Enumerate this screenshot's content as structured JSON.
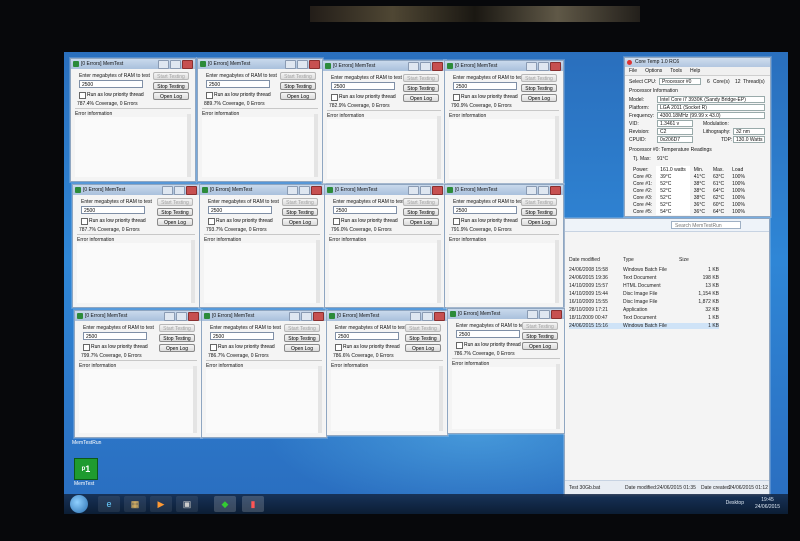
{
  "memtest": {
    "title": "[0 Errors] MemTest",
    "prompt": "Enter megabytes of RAM to test",
    "ram_value": "2500",
    "start_label": "Start Testing",
    "stop_label": "Stop Testing",
    "log_label": "Open Log",
    "priority_label": "Run as low priority thread",
    "error_label": "Error information",
    "windows": [
      {
        "coverage": "787.4% Coverage, 0 Errors"
      },
      {
        "coverage": "889.7% Coverage, 0 Errors"
      },
      {
        "coverage": "782.9% Coverage, 0 Errors"
      },
      {
        "coverage": "790.9% Coverage, 0 Errors"
      },
      {
        "coverage": "787.7% Coverage, 0 Errors"
      },
      {
        "coverage": "793.7% Coverage, 0 Errors"
      },
      {
        "coverage": "796.0% Coverage, 0 Errors"
      },
      {
        "coverage": "791.9% Coverage, 0 Errors"
      },
      {
        "coverage": "799.7% Coverage, 0 Errors"
      },
      {
        "coverage": "786.7% Coverage, 0 Errors"
      },
      {
        "coverage": "786.6% Coverage, 0 Errors"
      },
      {
        "coverage": "786.7% Coverage, 0 Errors"
      }
    ]
  },
  "coretemp": {
    "title": "Core Temp 1.0 RC6",
    "menu": [
      "File",
      "Options",
      "Tools",
      "Help"
    ],
    "select_cpu": "Select CPU:",
    "processor": "Processor #0",
    "cores": "6",
    "cores_label": "Core(s)",
    "threads": "12",
    "threads_label": "Thread(s)",
    "info_heading": "Processor Information",
    "model_label": "Model:",
    "model": "Intel Core i7 3930K (Sandy Bridge-EP)",
    "platform_label": "Platform:",
    "platform": "LGA 2011 (Socket R)",
    "frequency_label": "Frequency:",
    "frequency": "4300.18MHz (99.99 x 43.0)",
    "vid_label": "VID:",
    "vid": "1.3461 v",
    "modulation_label": "Modulation:",
    "revision_label": "Revision:",
    "revision": "C2",
    "lithography_label": "Lithography:",
    "lithography": "32 nm",
    "cpuid_label": "CPUID:",
    "cpuid": "0x206D7",
    "tdp_label": "TDP:",
    "tdp": "130.0 Watts",
    "temp_heading": "Processor #0: Temperature Readings",
    "tjmax_label": "Tj. Max:",
    "tjmax": "91°C",
    "power_label": "Power:",
    "power": "161.0 watts",
    "col_min": "Min.",
    "col_max": "Max.",
    "col_load": "Load",
    "cores_list": [
      {
        "name": "Core #0:",
        "temp": "39°C",
        "min": "41°C",
        "max": "63°C",
        "load": "100%"
      },
      {
        "name": "Core #1:",
        "temp": "52°C",
        "min": "38°C",
        "max": "61°C",
        "load": "100%"
      },
      {
        "name": "Core #2:",
        "temp": "52°C",
        "min": "38°C",
        "max": "64°C",
        "load": "100%"
      },
      {
        "name": "Core #3:",
        "temp": "52°C",
        "min": "38°C",
        "max": "62°C",
        "load": "100%"
      },
      {
        "name": "Core #4:",
        "temp": "52°C",
        "min": "36°C",
        "max": "60°C",
        "load": "100%"
      },
      {
        "name": "Core #5:",
        "temp": "54°C",
        "min": "36°C",
        "max": "64°C",
        "load": "100%"
      }
    ]
  },
  "explorer": {
    "search_placeholder": "Search MemTestRun",
    "col_date": "Date modified",
    "col_type": "Type",
    "col_size": "Size",
    "rows": [
      {
        "date": "24/06/2008 15:58",
        "type": "Windows Batch File",
        "size": "1 KB"
      },
      {
        "date": "24/06/2015 19:36",
        "type": "Text Document",
        "size": "198 KB"
      },
      {
        "date": "14/10/2009 15:57",
        "type": "HTML Document",
        "size": "13 KB"
      },
      {
        "date": "14/10/2009 15:44",
        "type": "Disc Image File",
        "size": "1,154 KB"
      },
      {
        "date": "16/10/2009 15:55",
        "type": "Disc Image File",
        "size": "1,872 KB"
      },
      {
        "date": "28/10/2009 17:21",
        "type": "Application",
        "size": "32 KB"
      },
      {
        "date": "18/11/2009 00:47",
        "type": "Text Document",
        "size": "1 KB"
      },
      {
        "date": "24/06/2015 15:16",
        "type": "Windows Batch File",
        "size": "1 KB"
      }
    ],
    "status_file": "Test 30Gb.bat",
    "status_modified_label": "Date modified:",
    "status_modified": "24/06/2015 01:35",
    "status_created_label": "Date created:",
    "status_created": "24/06/2015 01:12"
  },
  "desktop": {
    "label": "MemTestRun",
    "icon_caption": "MemTest"
  },
  "taskbar": {
    "tray_text": "Desktop",
    "time": "19:45",
    "date": "24/06/2015"
  }
}
